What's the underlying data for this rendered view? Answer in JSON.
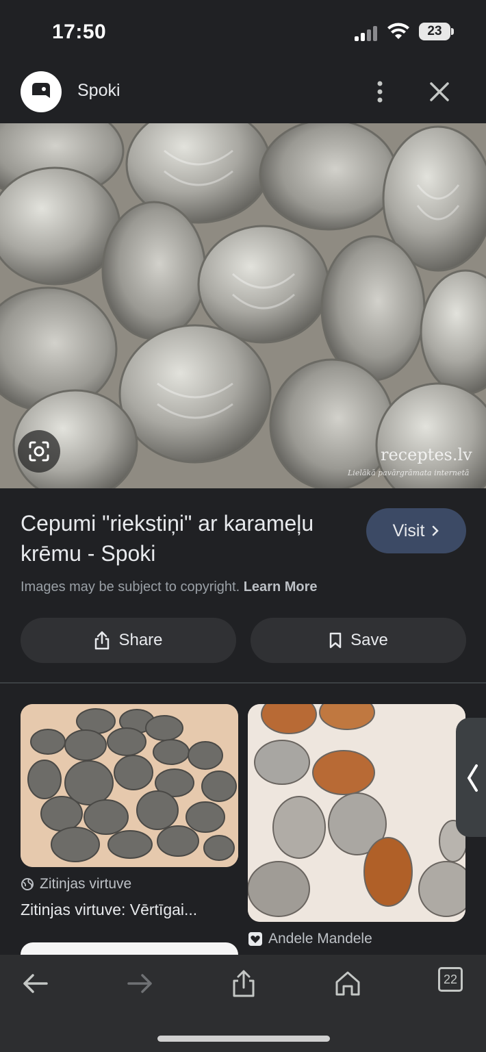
{
  "status_bar": {
    "time": "17:50",
    "battery": "23"
  },
  "header": {
    "site_name": "Spoki"
  },
  "main_image": {
    "watermark": "receptes.lv",
    "watermark_sub": "Lielākā pavārgrāmata internetā"
  },
  "result": {
    "title": "Cepumi \"riekstiņi\" ar karameļu krēmu - Spoki",
    "visit_label": "Visit",
    "copyright_text": "Images may be subject to copyright.",
    "learn_more": "Learn More",
    "share_label": "Share",
    "save_label": "Save"
  },
  "related": [
    {
      "source": "Zitinjas virtuve",
      "title": "Zitinjas virtuve: Vērtīgai..."
    },
    {
      "source": "Andele Mandele"
    }
  ],
  "bottom_bar": {
    "tab_count": "22"
  }
}
